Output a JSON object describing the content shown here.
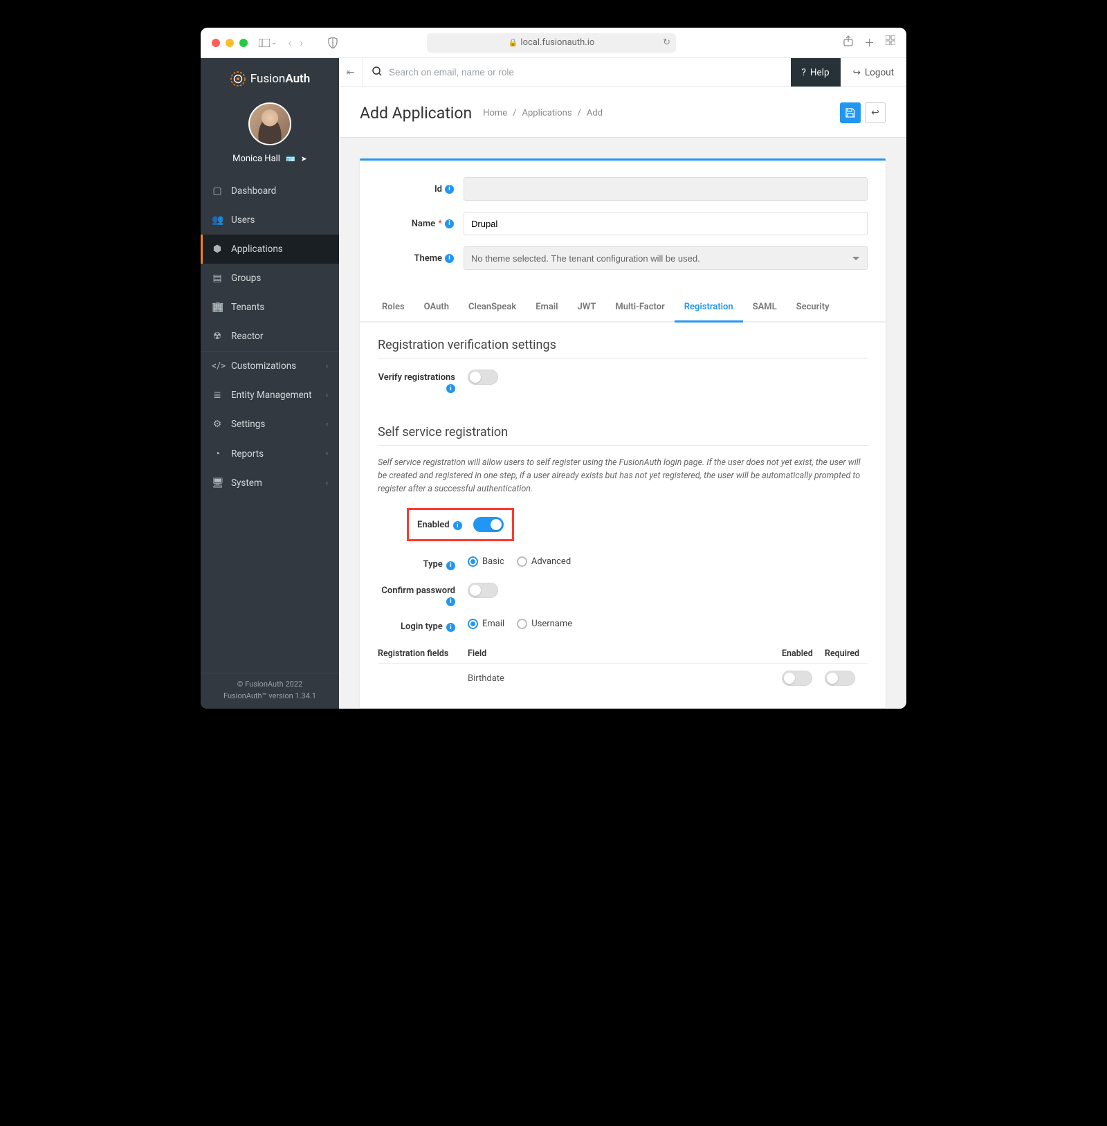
{
  "browser": {
    "url": "local.fusionauth.io"
  },
  "logo": {
    "brand_a": "Fusion",
    "brand_b": "Auth"
  },
  "user": {
    "name": "Monica Hall"
  },
  "sidebar": {
    "items": [
      {
        "icon": "▢",
        "label": "Dashboard"
      },
      {
        "icon": "👥",
        "label": "Users"
      },
      {
        "icon": "⬢",
        "label": "Applications",
        "active": true
      },
      {
        "icon": "▤",
        "label": "Groups"
      },
      {
        "icon": "🏢",
        "label": "Tenants"
      },
      {
        "icon": "☢",
        "label": "Reactor"
      }
    ],
    "items2": [
      {
        "icon": "</>",
        "label": "Customizations"
      },
      {
        "icon": "≣",
        "label": "Entity Management"
      },
      {
        "icon": "⚙",
        "label": "Settings"
      },
      {
        "icon": "◔",
        "label": "Reports"
      },
      {
        "icon": "🖥",
        "label": "System"
      }
    ]
  },
  "footer": {
    "line1": "© FusionAuth 2022",
    "line2": "FusionAuth™ version 1.34.1"
  },
  "topbar": {
    "search_placeholder": "Search on email, name or role",
    "help": "Help",
    "logout": "Logout"
  },
  "header": {
    "title": "Add Application",
    "crumbs": [
      "Home",
      "Applications",
      "Add"
    ]
  },
  "form": {
    "id_label": "Id",
    "name_label": "Name",
    "name_value": "Drupal",
    "theme_label": "Theme",
    "theme_value": "No theme selected. The tenant configuration will be used."
  },
  "tabs": [
    "Roles",
    "OAuth",
    "CleanSpeak",
    "Email",
    "JWT",
    "Multi-Factor",
    "Registration",
    "SAML",
    "Security"
  ],
  "active_tab": "Registration",
  "section1": {
    "title": "Registration verification settings",
    "verify_label": "Verify registrations"
  },
  "section2": {
    "title": "Self service registration",
    "desc": "Self service registration will allow users to self register using the FusionAuth login page. If the user does not yet exist, the user will be created and registered in one step, if a user already exists but has not yet registered, the user will be automatically prompted to register after a successful authentication.",
    "enabled_label": "Enabled",
    "type_label": "Type",
    "type_basic": "Basic",
    "type_advanced": "Advanced",
    "confirm_label": "Confirm password",
    "login_type_label": "Login type",
    "login_email": "Email",
    "login_username": "Username",
    "reg_fields_label": "Registration fields",
    "col_field": "Field",
    "col_enabled": "Enabled",
    "col_required": "Required",
    "field_birthdate": "Birthdate"
  }
}
